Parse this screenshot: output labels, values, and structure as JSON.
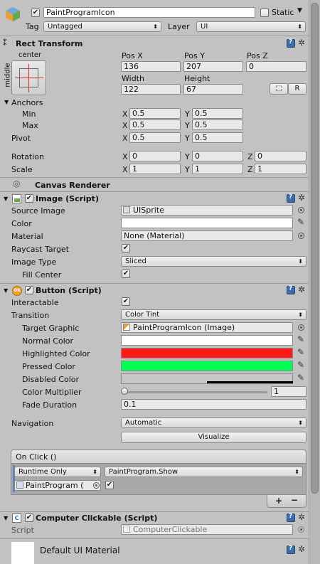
{
  "gameobject": {
    "name": "PaintProgramIcon",
    "active": true,
    "static_label": "Static",
    "tag_label": "Tag",
    "tag_value": "Untagged",
    "layer_label": "Layer",
    "layer_value": "UI"
  },
  "rect_transform": {
    "title": "Rect Transform",
    "anchor_top_label": "center",
    "anchor_side_label": "middle",
    "pos_x_label": "Pos X",
    "pos_x": "136",
    "pos_y_label": "Pos Y",
    "pos_y": "207",
    "pos_z_label": "Pos Z",
    "pos_z": "0",
    "width_label": "Width",
    "width": "122",
    "height_label": "Height",
    "height": "67",
    "raw_button": "R",
    "anchors_label": "Anchors",
    "min_label": "Min",
    "min_x": "0.5",
    "min_y": "0.5",
    "max_label": "Max",
    "max_x": "0.5",
    "max_y": "0.5",
    "pivot_label": "Pivot",
    "pivot_x": "0.5",
    "pivot_y": "0.5",
    "rotation_label": "Rotation",
    "rot_x": "0",
    "rot_y": "0",
    "rot_z": "0",
    "scale_label": "Scale",
    "scale_x": "1",
    "scale_y": "1",
    "scale_z": "1",
    "axis_x": "X",
    "axis_y": "Y",
    "axis_z": "Z"
  },
  "canvas_renderer": {
    "title": "Canvas Renderer"
  },
  "image": {
    "title": "Image (Script)",
    "source_image_label": "Source Image",
    "source_image": "UISprite",
    "color_label": "Color",
    "material_label": "Material",
    "material": "None (Material)",
    "raycast_label": "Raycast Target",
    "image_type_label": "Image Type",
    "image_type": "Sliced",
    "fill_center_label": "Fill Center"
  },
  "button": {
    "title": "Button (Script)",
    "interactable_label": "Interactable",
    "transition_label": "Transition",
    "transition": "Color Tint",
    "target_graphic_label": "Target Graphic",
    "target_graphic": "PaintProgramIcon (Image)",
    "normal_color_label": "Normal Color",
    "highlighted_color_label": "Highlighted Color",
    "pressed_color_label": "Pressed Color",
    "disabled_color_label": "Disabled Color",
    "color_multiplier_label": "Color Multiplier",
    "color_multiplier": "1",
    "fade_duration_label": "Fade Duration",
    "fade_duration": "0.1",
    "navigation_label": "Navigation",
    "navigation": "Automatic",
    "visualize_button": "Visualize",
    "on_click_label": "On Click ()",
    "runtime_option": "Runtime Only",
    "function": "PaintProgram.Show",
    "target_object": "PaintProgram (",
    "add_button": "+",
    "remove_button": "−"
  },
  "computer_clickable": {
    "title": "Computer Clickable (Script)",
    "script_label": "Script",
    "script": "ComputerClickable"
  },
  "material_footer": {
    "title": "Default UI Material"
  },
  "colors": {
    "normal": "#ffffff",
    "highlighted": "#ff1a1a",
    "pressed": "#00ff55",
    "disabled": "#c8c8c8",
    "image_color": "#ffffff"
  }
}
